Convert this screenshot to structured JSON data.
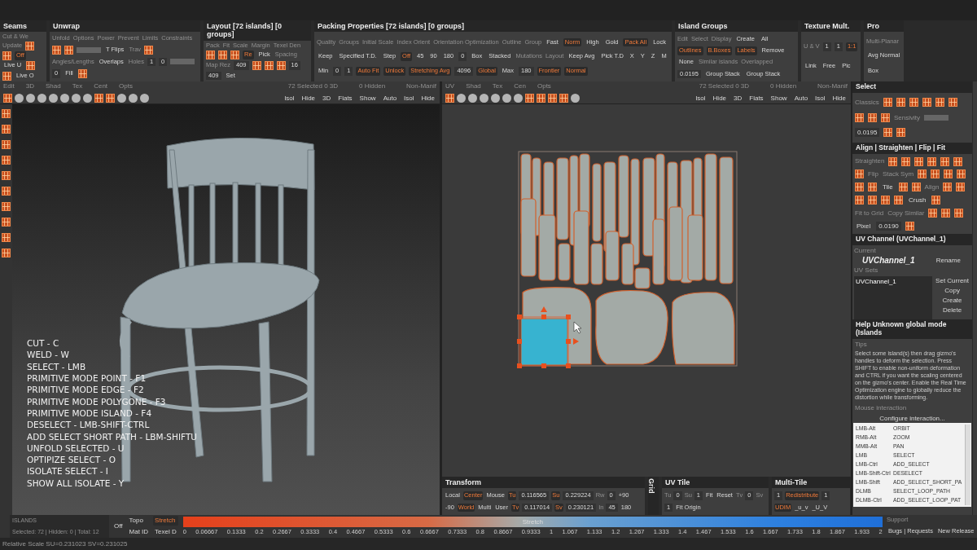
{
  "top_panels": [
    {
      "title": "Seams",
      "controls": [
        {
          "kind": "label",
          "text": "Cut & We"
        },
        {
          "kind": "label",
          "text": "Update"
        },
        {
          "kind": "icon"
        },
        {
          "kind": "icon"
        },
        {
          "kind": "active",
          "text": "Off"
        },
        {
          "kind": "button",
          "text": "Live U"
        },
        {
          "kind": "icon"
        },
        {
          "kind": "icon"
        },
        {
          "kind": "button",
          "text": "Live O"
        }
      ]
    },
    {
      "title": "Unwrap",
      "controls": [
        {
          "kind": "label",
          "text": "Unfold"
        },
        {
          "kind": "label",
          "text": "Options"
        },
        {
          "kind": "label",
          "text": "Power"
        },
        {
          "kind": "label",
          "text": "Prevent"
        },
        {
          "kind": "label",
          "text": "Limits"
        },
        {
          "kind": "label",
          "text": "Constraints"
        },
        {
          "kind": "icon"
        },
        {
          "kind": "icon"
        },
        {
          "kind": "slider"
        },
        {
          "kind": "button",
          "text": "T Flips"
        },
        {
          "kind": "label",
          "text": "Trav"
        },
        {
          "kind": "icon"
        },
        {
          "kind": "label",
          "text": "Angles/Lengths"
        },
        {
          "kind": "button",
          "text": "Overlaps"
        },
        {
          "kind": "label",
          "text": "Holes"
        },
        {
          "kind": "value",
          "text": "1"
        },
        {
          "kind": "value",
          "text": "0"
        },
        {
          "kind": "slider"
        },
        {
          "kind": "value",
          "text": "0"
        },
        {
          "kind": "button",
          "text": "Fill"
        },
        {
          "kind": "icon"
        }
      ]
    },
    {
      "title": "Layout [72 islands] [0 groups]",
      "controls": [
        {
          "kind": "label",
          "text": "Pack"
        },
        {
          "kind": "label",
          "text": "Fit"
        },
        {
          "kind": "label",
          "text": "Scale"
        },
        {
          "kind": "label",
          "text": "Margin"
        },
        {
          "kind": "label",
          "text": "Texel Den"
        },
        {
          "kind": "icon"
        },
        {
          "kind": "icon"
        },
        {
          "kind": "icon"
        },
        {
          "kind": "active",
          "text": "Re"
        },
        {
          "kind": "button",
          "text": "Pick"
        },
        {
          "kind": "label",
          "text": "Spacing"
        },
        {
          "kind": "label",
          "text": "Map Rez"
        },
        {
          "kind": "value",
          "text": "409"
        },
        {
          "kind": "icon"
        },
        {
          "kind": "icon"
        },
        {
          "kind": "icon"
        },
        {
          "kind": "value",
          "text": "16"
        },
        {
          "kind": "value",
          "text": "409"
        },
        {
          "kind": "button",
          "text": "Set"
        }
      ]
    },
    {
      "title": "Packing Properties [72 islands] [0 groups]",
      "controls": [
        {
          "kind": "label",
          "text": "Quality"
        },
        {
          "kind": "label",
          "text": "Groups"
        },
        {
          "kind": "label",
          "text": "Initial Scale"
        },
        {
          "kind": "label",
          "text": "Index Orient"
        },
        {
          "kind": "label",
          "text": "Orientation Optimization"
        },
        {
          "kind": "label",
          "text": "Outline"
        },
        {
          "kind": "label",
          "text": "Group"
        },
        {
          "kind": "button",
          "text": "Fast"
        },
        {
          "kind": "active",
          "text": "Norm"
        },
        {
          "kind": "button",
          "text": "High"
        },
        {
          "kind": "button",
          "text": "Gold"
        },
        {
          "kind": "active",
          "text": "Pack All"
        },
        {
          "kind": "button",
          "text": "Lock"
        },
        {
          "kind": "button",
          "text": "Keep"
        },
        {
          "kind": "button",
          "text": "Specified T.D."
        },
        {
          "kind": "button",
          "text": "Step"
        },
        {
          "kind": "active",
          "text": "Off"
        },
        {
          "kind": "button",
          "text": "45"
        },
        {
          "kind": "button",
          "text": "90"
        },
        {
          "kind": "button",
          "text": "180"
        },
        {
          "kind": "value",
          "text": "0"
        },
        {
          "kind": "button",
          "text": "Box"
        },
        {
          "kind": "button",
          "text": "Stacked"
        },
        {
          "kind": "label",
          "text": "Mutations"
        },
        {
          "kind": "label",
          "text": "Layout"
        },
        {
          "kind": "button",
          "text": "Keep Avg"
        },
        {
          "kind": "button",
          "text": "Pick T.D"
        },
        {
          "kind": "button",
          "text": "X"
        },
        {
          "kind": "button",
          "text": "Y"
        },
        {
          "kind": "button",
          "text": "Z"
        },
        {
          "kind": "button",
          "text": "M"
        },
        {
          "kind": "button",
          "text": "Min"
        },
        {
          "kind": "value",
          "text": "0"
        },
        {
          "kind": "value",
          "text": "1"
        },
        {
          "kind": "active",
          "text": "Auto Fit"
        },
        {
          "kind": "active",
          "text": "Unlock"
        },
        {
          "kind": "active",
          "text": "Stretching Avg"
        },
        {
          "kind": "value",
          "text": "4096"
        },
        {
          "kind": "active",
          "text": "Global"
        },
        {
          "kind": "button",
          "text": "Max"
        },
        {
          "kind": "value",
          "text": "180"
        },
        {
          "kind": "active",
          "text": "Frontier"
        },
        {
          "kind": "active",
          "text": "Normal"
        }
      ]
    },
    {
      "title": "Island Groups",
      "controls": [
        {
          "kind": "label",
          "text": "Edit"
        },
        {
          "kind": "label",
          "text": "Select"
        },
        {
          "kind": "label",
          "text": "Display"
        },
        {
          "kind": "button",
          "text": "Create"
        },
        {
          "kind": "button",
          "text": "All"
        },
        {
          "kind": "active",
          "text": "Outlines"
        },
        {
          "kind": "active",
          "text": "B.Boxes"
        },
        {
          "kind": "active",
          "text": "Labels"
        },
        {
          "kind": "button",
          "text": "Remove"
        },
        {
          "kind": "button",
          "text": "None"
        },
        {
          "kind": "label",
          "text": "Similar islands"
        },
        {
          "kind": "label",
          "text": "Overlapped"
        },
        {
          "kind": "value",
          "text": "0.0195"
        },
        {
          "kind": "button",
          "text": "Group Stack"
        },
        {
          "kind": "button",
          "text": "Group Stack"
        }
      ]
    },
    {
      "title": "Texture Mult.",
      "controls": [
        {
          "kind": "label",
          "text": "U & V"
        },
        {
          "kind": "value",
          "text": "1"
        },
        {
          "kind": "value",
          "text": "1"
        },
        {
          "kind": "active",
          "text": "1:1"
        },
        {
          "kind": "button",
          "text": "Link"
        },
        {
          "kind": "button",
          "text": "Free"
        },
        {
          "kind": "button",
          "text": "Pic"
        }
      ]
    },
    {
      "title": "Pro",
      "controls": [
        {
          "kind": "label",
          "text": "Multi-Planar"
        },
        {
          "kind": "button",
          "text": "Avg Normal"
        },
        {
          "kind": "button",
          "text": "Box"
        }
      ]
    }
  ],
  "view_3d": {
    "toolbar": {
      "labels": [
        "Edit",
        "3D",
        "Shad",
        "Tex",
        "Cent",
        "Opts"
      ],
      "tools": [
        {
          "kind": "icon"
        },
        {
          "kind": "ball"
        },
        {
          "kind": "ball"
        },
        {
          "kind": "ball"
        },
        {
          "kind": "ball"
        },
        {
          "kind": "ball"
        },
        {
          "kind": "ball"
        },
        {
          "kind": "ball"
        },
        {
          "kind": "icon"
        },
        {
          "kind": "icon"
        },
        {
          "kind": "ball"
        },
        {
          "kind": "ball"
        },
        {
          "kind": "ball"
        }
      ],
      "stats": [
        "72 Selected 0 3D",
        "0 Hidden",
        "Non-Manif"
      ],
      "actions": [
        "Isol",
        "Hide",
        "3D",
        "Flats",
        "Show",
        "Auto",
        "Isol",
        "Hide"
      ]
    },
    "shortcuts": [
      "CUT - C",
      "WELD - W",
      "SELECT - LMB",
      "PRIMITIVE MODE POINT - F1",
      "PRIMITIVE MODE EDGE - F2",
      "PRIMITIVE MODE POLYGONE - F3",
      "PRIMITIVE MODE ISLAND - F4",
      "DESELECT - LMB-SHIFT-CTRL",
      "ADD SELECT SHORT PATH - LBM-SHIFTU",
      "UNFOLD SELECTED - U",
      "OPTIPIZE SELECT - O",
      "ISOLATE SELECT - I",
      "SHOW ALL ISOLATE - Y"
    ]
  },
  "view_uv": {
    "toolbar": {
      "labels": [
        "UV",
        "Shad",
        "Tex",
        "Cen",
        "Opts"
      ],
      "tools": [
        {
          "kind": "icon"
        },
        {
          "kind": "ball"
        },
        {
          "kind": "ball"
        },
        {
          "kind": "ball"
        },
        {
          "kind": "ball"
        },
        {
          "kind": "ball"
        },
        {
          "kind": "ball"
        },
        {
          "kind": "icon"
        },
        {
          "kind": "icon"
        },
        {
          "kind": "icon"
        },
        {
          "kind": "icon"
        },
        {
          "kind": "ball"
        }
      ],
      "stats": [
        "72 Selected 0 3D",
        "0 Hidden",
        "Non-Manif"
      ],
      "actions": [
        "Isol",
        "Hide",
        "3D",
        "Flats",
        "Show",
        "Auto",
        "Isol",
        "Hide"
      ]
    }
  },
  "bottom_panels": [
    {
      "title": "Transform",
      "controls": [
        {
          "kind": "button",
          "text": "Local"
        },
        {
          "kind": "active",
          "text": "Center"
        },
        {
          "kind": "button",
          "text": "Mouse"
        },
        {
          "kind": "active",
          "text": "Tu"
        },
        {
          "kind": "value",
          "text": "0.116565"
        },
        {
          "kind": "active",
          "text": "Su"
        },
        {
          "kind": "value",
          "text": "0.229224"
        },
        {
          "kind": "label",
          "text": "Rw"
        },
        {
          "kind": "value",
          "text": "0"
        },
        {
          "kind": "button",
          "text": "+90"
        },
        {
          "kind": "button",
          "text": "-90"
        },
        {
          "kind": "active",
          "text": "World"
        },
        {
          "kind": "button",
          "text": "Multi"
        },
        {
          "kind": "button",
          "text": "User"
        },
        {
          "kind": "active",
          "text": "Tv"
        },
        {
          "kind": "value",
          "text": "0.117014"
        },
        {
          "kind": "active",
          "text": "Sv"
        },
        {
          "kind": "value",
          "text": "0.230121"
        },
        {
          "kind": "label",
          "text": "In"
        },
        {
          "kind": "value",
          "text": "45"
        },
        {
          "kind": "button",
          "text": "180"
        }
      ]
    },
    {
      "title": "Grid"
    },
    {
      "title": "UV Tile",
      "controls": [
        {
          "kind": "label",
          "text": "Tu"
        },
        {
          "kind": "value",
          "text": "0"
        },
        {
          "kind": "label",
          "text": "Su"
        },
        {
          "kind": "value",
          "text": "1"
        },
        {
          "kind": "button",
          "text": "Fit"
        },
        {
          "kind": "button",
          "text": "Reset"
        },
        {
          "kind": "label",
          "text": "Tv"
        },
        {
          "kind": "value",
          "text": "0"
        },
        {
          "kind": "label",
          "text": "Sv"
        },
        {
          "kind": "value",
          "text": "1"
        },
        {
          "kind": "button",
          "text": "Fit Origin"
        }
      ]
    },
    {
      "title": "Multi-Tile",
      "controls": [
        {
          "kind": "value",
          "text": "1"
        },
        {
          "kind": "active",
          "text": "Redistribute"
        },
        {
          "kind": "value",
          "text": "1"
        },
        {
          "kind": "active",
          "text": "UDIM"
        },
        {
          "kind": "button",
          "text": "_u_v"
        },
        {
          "kind": "button",
          "text": "_U_V"
        }
      ]
    }
  ],
  "side_panels": [
    {
      "title": "Select",
      "controls": [
        {
          "kind": "label",
          "text": "Classics"
        },
        {
          "kind": "icon"
        },
        {
          "kind": "icon"
        },
        {
          "kind": "icon"
        },
        {
          "kind": "icon"
        },
        {
          "kind": "icon"
        },
        {
          "kind": "icon"
        },
        {
          "kind": "icon"
        },
        {
          "kind": "icon"
        },
        {
          "kind": "icon"
        },
        {
          "kind": "label",
          "text": "Sensivity"
        },
        {
          "kind": "slider"
        },
        {
          "kind": "value",
          "text": "0.0195"
        },
        {
          "kind": "icon"
        },
        {
          "kind": "icon"
        }
      ]
    },
    {
      "title": "Align | Straighten | Flip | Fit",
      "controls": [
        {
          "kind": "label",
          "text": "Straighten"
        },
        {
          "kind": "icon"
        },
        {
          "kind": "icon"
        },
        {
          "kind": "icon"
        },
        {
          "kind": "icon"
        },
        {
          "kind": "icon"
        },
        {
          "kind": "icon"
        },
        {
          "kind": "icon"
        },
        {
          "kind": "label",
          "text": "Flip"
        },
        {
          "kind": "label",
          "text": "Stack Sym"
        },
        {
          "kind": "icon"
        },
        {
          "kind": "icon"
        },
        {
          "kind": "icon"
        },
        {
          "kind": "icon"
        },
        {
          "kind": "icon"
        },
        {
          "kind": "icon"
        },
        {
          "kind": "button",
          "text": "Tile"
        },
        {
          "kind": "icon"
        },
        {
          "kind": "icon"
        },
        {
          "kind": "label",
          "text": "Align"
        },
        {
          "kind": "icon"
        },
        {
          "kind": "icon"
        },
        {
          "kind": "icon"
        },
        {
          "kind": "icon"
        },
        {
          "kind": "icon"
        },
        {
          "kind": "icon"
        },
        {
          "kind": "button",
          "text": "Crush"
        },
        {
          "kind": "icon"
        },
        {
          "kind": "label",
          "text": "Fit to Grid"
        },
        {
          "kind": "label",
          "text": "Copy Similar"
        },
        {
          "kind": "icon"
        },
        {
          "kind": "icon"
        },
        {
          "kind": "icon"
        },
        {
          "kind": "button",
          "text": "Pixel"
        },
        {
          "kind": "value",
          "text": "0.0190"
        },
        {
          "kind": "icon"
        }
      ]
    }
  ],
  "uv_channel": {
    "title": "UV Channel (UVChannel_1)",
    "current_label": "Current",
    "current": "UVChannel_1",
    "rename": "Rename",
    "sets_label": "UV Sets",
    "sets": [
      {
        "name": "UVChannel_1",
        "selected": true
      }
    ],
    "actions": [
      "Set Current",
      "Copy",
      "Create",
      "Delete"
    ]
  },
  "help": {
    "title": "Help Unknown global mode (Islands",
    "tips_label": "Tips",
    "tips": "Select some island(s) then drag gizmo's handles to deform the selection. Press SHIFT to enable non-uniform deformation and CTRL if you want the scaling centered on the gizmo's center. Enable the Real Time Optimization engine to globally reduce the distortion while transforming.",
    "mouse_label": "Mouse interaction",
    "configure": "Configure interaction...",
    "bindings": [
      {
        "input": "LMB-Alt",
        "action": "ORBIT"
      },
      {
        "input": "RMB-Alt",
        "action": "ZOOM"
      },
      {
        "input": "MMB-Alt",
        "action": "PAN"
      },
      {
        "input": "LMB",
        "action": "SELECT"
      },
      {
        "input": "LMB-Ctrl",
        "action": "ADD_SELECT"
      },
      {
        "input": "LMB-Shift-Ctrl",
        "action": "DESELECT"
      },
      {
        "input": "LMB-Shift",
        "action": "ADD_SELECT_SHORT_PA"
      },
      {
        "input": "DLMB",
        "action": "SELECT_LOOP_PATH"
      },
      {
        "input": "DLMB-Ctrl",
        "action": "ADD_SELECT_LOOP_PAT"
      }
    ]
  },
  "stretch_bar": {
    "mode_label": "ISLANDS",
    "counts": "Selected: 72 | Hidden: 0 | Total: 12",
    "modes": [
      {
        "text": "Off",
        "selected": false
      },
      {
        "text": "Topo",
        "selected": false
      },
      {
        "text": "Stretch",
        "selected": true
      },
      {
        "text": "Mat ID",
        "selected": false
      },
      {
        "text": "Texel D",
        "selected": false
      }
    ],
    "bar_label": "Stretch",
    "ticks": [
      "0",
      "0.06667",
      "0.1333",
      "0.2",
      "0.2667",
      "0.3333",
      "0.4",
      "0.4667",
      "0.5333",
      "0.6",
      "0.6667",
      "0.7333",
      "0.8",
      "0.8667",
      "0.9333",
      "1",
      "1.067",
      "1.133",
      "1.2",
      "1.267",
      "1.333",
      "1.4",
      "1.467",
      "1.533",
      "1.6",
      "1.667",
      "1.733",
      "1.8",
      "1.867",
      "1.933",
      "2"
    ],
    "support": "Support",
    "links": [
      "Bugs | Requests",
      "New Release"
    ]
  },
  "status_bar": "Relative Scale SU=0.231023 SV=0.231025"
}
